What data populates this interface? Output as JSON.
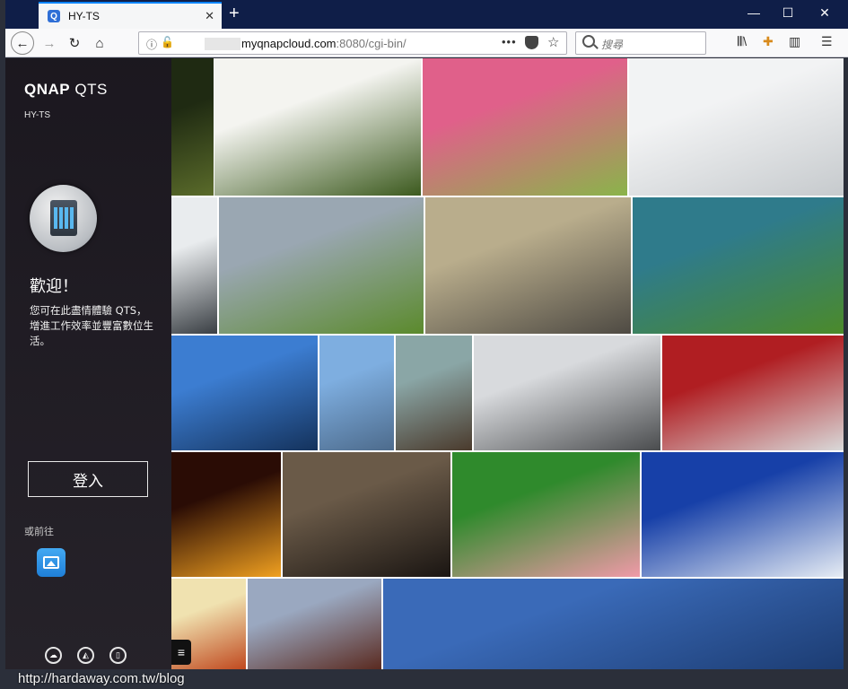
{
  "browser": {
    "tab_title": "HY-TS",
    "tab_favicon": "Q",
    "tab_close": "✕",
    "new_tab": "+",
    "window_controls": {
      "minimize": "—",
      "maximize": "☐",
      "close": "✕"
    },
    "url_host": "myqnapcloud.com",
    "url_rest": ":8080/cgi-bin/",
    "url_actions": "•••",
    "search_placeholder": "搜尋",
    "nav_icons": [
      "back-arrow-icon",
      "forward-arrow-icon",
      "reload-icon",
      "home-icon"
    ],
    "toolbar_icons": [
      "library-icon",
      "extension-icon",
      "sidebar-icon",
      "menu-icon"
    ]
  },
  "sidebar": {
    "brand_bold": "QNAP",
    "brand_light": " QTS",
    "hostname": "HY-TS",
    "welcome": "歡迎！",
    "description": "您可在此盡情體驗 QTS，增進工作效率並豐富數位生活。",
    "login_label": "登入",
    "goto_label": "或前往",
    "app_icon": "photo-station-icon",
    "footer_icons": [
      "cloud-icon",
      "compass-icon",
      "book-icon"
    ],
    "menu_toggle": "≡"
  },
  "photos": [
    {
      "name": "photo-tree-reflection",
      "c1": "#1f2a12",
      "c2": "#5a6b2a"
    },
    {
      "name": "photo-white-cyclamen",
      "c1": "#f4f4f0",
      "c2": "#3c5a1e"
    },
    {
      "name": "photo-pink-blossom",
      "c1": "#e0608a",
      "c2": "#8ab44a"
    },
    {
      "name": "photo-foggy-pier",
      "c1": "#f2f3f4",
      "c2": "#c6cacd"
    },
    {
      "name": "photo-ocean-waves",
      "c1": "#e9ecee",
      "c2": "#3a3f44"
    },
    {
      "name": "photo-red-tractor",
      "c1": "#9aa7b2",
      "c2": "#5b8a2c"
    },
    {
      "name": "photo-street-intersection",
      "c1": "#b9ad8c",
      "c2": "#4e4a43"
    },
    {
      "name": "photo-stone-fish-weir",
      "c1": "#2f7b8b",
      "c2": "#4b8a2a"
    },
    {
      "name": "photo-stilt-houses",
      "c1": "#3c7dd1",
      "c2": "#14325c"
    },
    {
      "name": "photo-harbor-boat",
      "c1": "#7eaee0",
      "c2": "#4d6b8c"
    },
    {
      "name": "photo-rock-shore",
      "c1": "#8aa6a6",
      "c2": "#4a3a2c"
    },
    {
      "name": "photo-canal-warehouses",
      "c1": "#d8dadd",
      "c2": "#4a4c4e"
    },
    {
      "name": "photo-race-car",
      "c1": "#b01e22",
      "c2": "#d9d9d9"
    },
    {
      "name": "photo-carousel",
      "c1": "#2a0c05",
      "c2": "#f0a020"
    },
    {
      "name": "photo-rainy-window",
      "c1": "#6a5a48",
      "c2": "#1a1512"
    },
    {
      "name": "photo-pink-flower",
      "c1": "#2f8a2c",
      "c2": "#f09aa8"
    },
    {
      "name": "photo-blue-sky-cliff",
      "c1": "#1740a8",
      "c2": "#e6ecf4"
    },
    {
      "name": "photo-food-plate",
      "c1": "#f0e2b0",
      "c2": "#c0491f"
    },
    {
      "name": "photo-brick-warehouse",
      "c1": "#9aa8c0",
      "c2": "#5a2a20"
    },
    {
      "name": "photo-sky-panorama",
      "c1": "#3a6ab8",
      "c2": "#1c3c72"
    }
  ],
  "watermark": "http://hardaway.com.tw/blog"
}
